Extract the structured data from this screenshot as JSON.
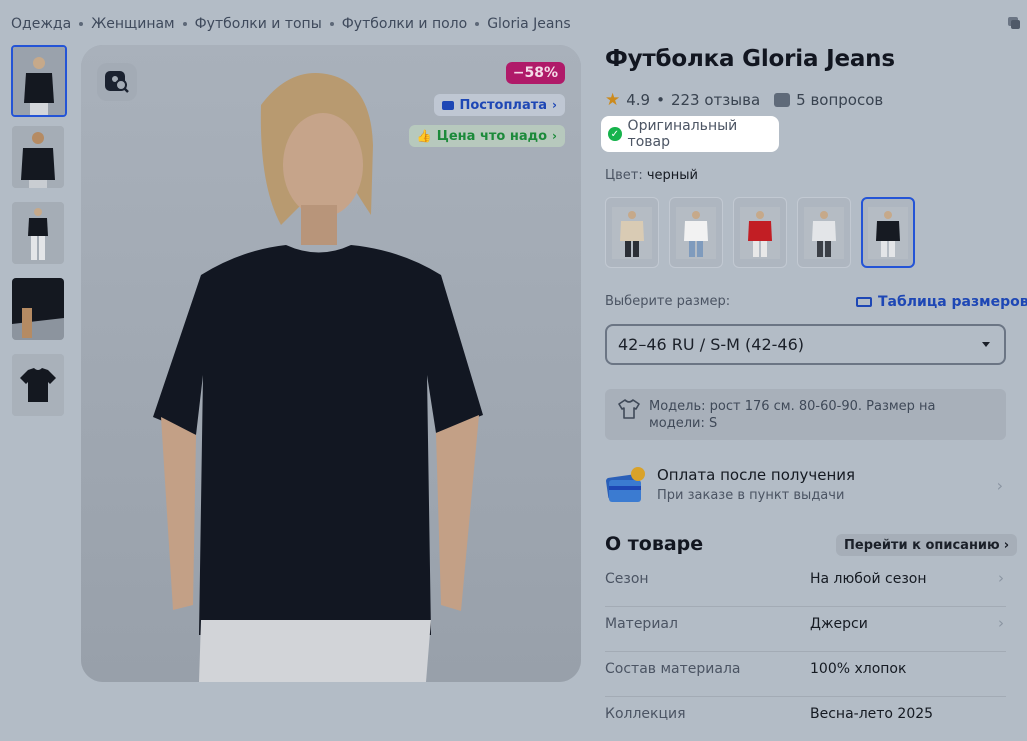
{
  "breadcrumb": [
    "Одежда",
    "Женщинам",
    "Футболки и топы",
    "Футболки и поло",
    "Gloria Jeans"
  ],
  "product": {
    "title": "Футболка Gloria Jeans",
    "rating": "4.9",
    "reviews": "223 отзыва",
    "questions": "5 вопросов",
    "original_label": "Оригинальный товар"
  },
  "gallery": {
    "discount": "−58%",
    "postpay_label": "Постоплата",
    "price_label": "Цена что надо",
    "thumbnail_count": 5,
    "selected_thumbnail": 1
  },
  "color": {
    "label": "Цвет:",
    "value": "черный",
    "swatches": [
      {
        "shirt": "#d9cbb4"
      },
      {
        "shirt": "#f2f2f2"
      },
      {
        "shirt": "#c21e24"
      },
      {
        "shirt": "#e3e5e8"
      },
      {
        "shirt": "#161a22"
      }
    ],
    "selected_index": 5
  },
  "size": {
    "label": "Выберите размер:",
    "table_link": "Таблица размеров",
    "selected": "42–46 RU / S-M (42-46)"
  },
  "model_info": "Модель: рост 176 см. 80-60-90. Размер на модели: S",
  "payment": {
    "title": "Оплата после получения",
    "subtitle": "При заказе в пункт выдачи"
  },
  "about": {
    "title": "О товаре",
    "link": "Перейти к описанию",
    "properties": [
      {
        "key": "Сезон",
        "value": "На любой сезон",
        "has_chevron": true
      },
      {
        "key": "Материал",
        "value": "Джерси",
        "has_chevron": true
      },
      {
        "key": "Состав материала",
        "value": "100% хлопок",
        "has_chevron": false
      },
      {
        "key": "Коллекция",
        "value": "Весна-лето 2025",
        "has_chevron": false
      }
    ]
  },
  "colors": {
    "accent": "#2454d6",
    "discount": "#b01a69",
    "success": "#16b34c",
    "overlay": "#b3bcc6"
  }
}
